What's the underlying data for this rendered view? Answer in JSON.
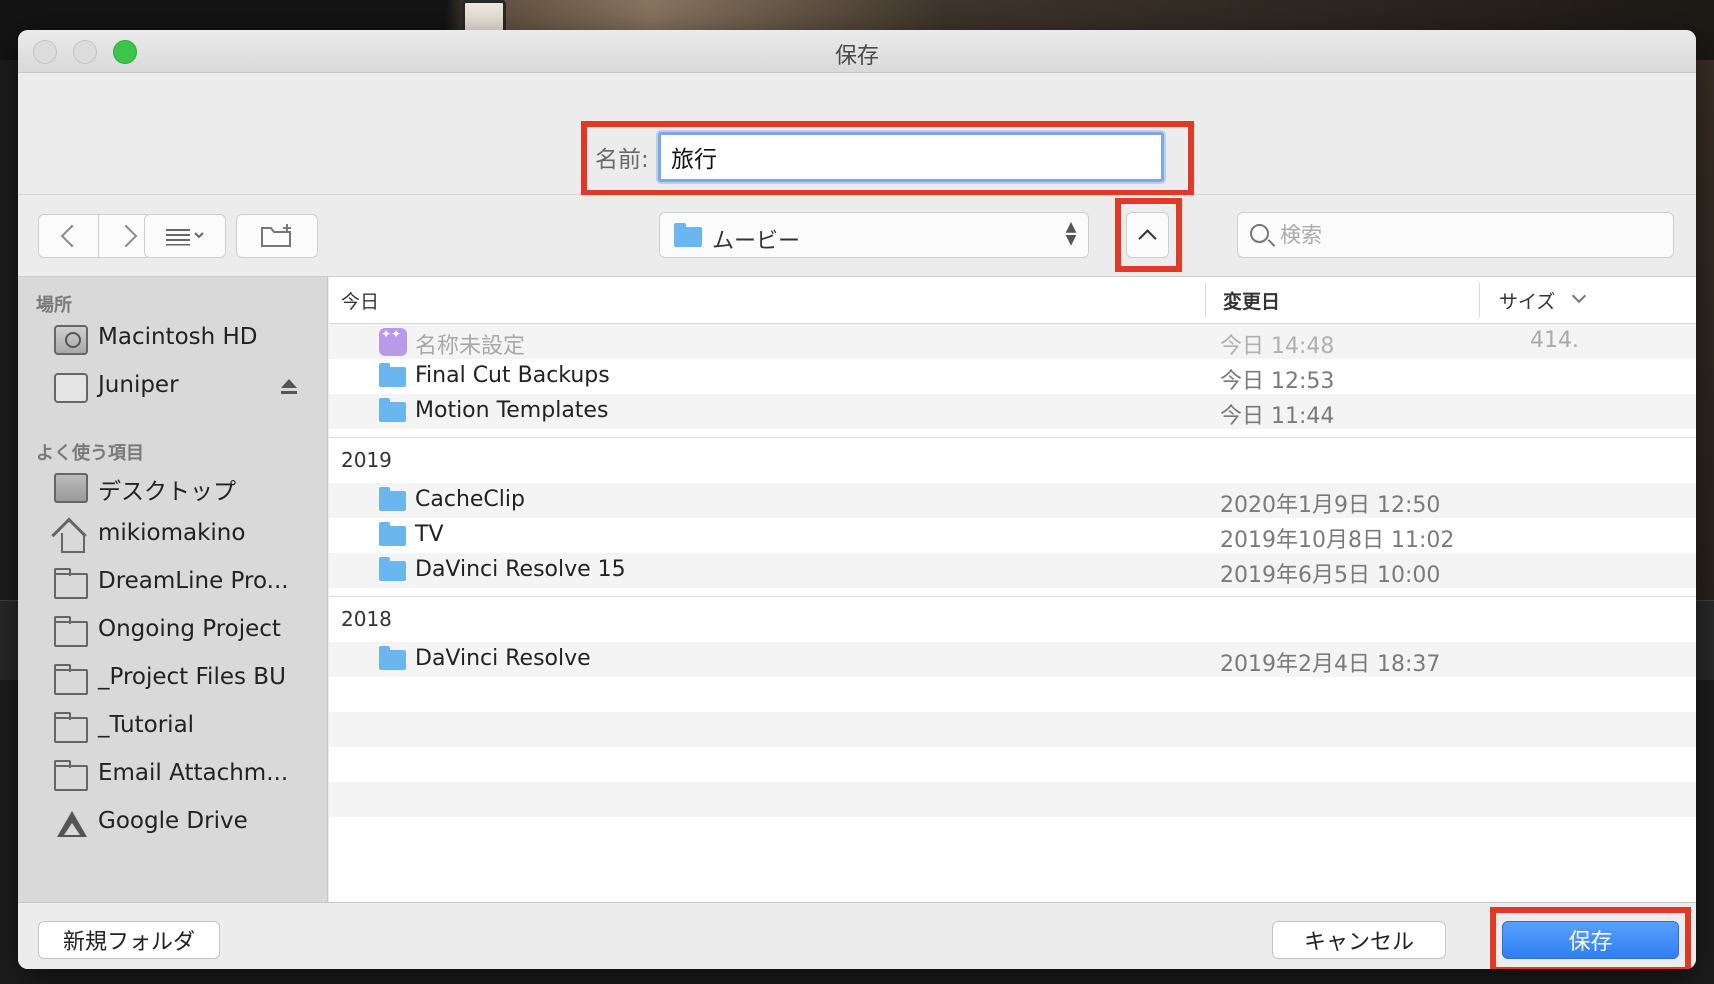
{
  "window": {
    "title": "保存"
  },
  "name_row": {
    "label": "名前:",
    "value": "旅行"
  },
  "toolbar": {
    "location": "ムービー",
    "search_placeholder": "検索"
  },
  "sidebar": {
    "sections": [
      {
        "title": "場所",
        "items": [
          {
            "label": "Macintosh HD",
            "icon": "hard-drive-icon"
          },
          {
            "label": "Juniper",
            "icon": "external-drive-icon",
            "eject": true
          }
        ]
      },
      {
        "title": "よく使う項目",
        "items": [
          {
            "label": "デスクトップ",
            "icon": "desktop-icon"
          },
          {
            "label": "mikiomakino",
            "icon": "home-icon"
          },
          {
            "label": "DreamLine Pro...",
            "icon": "folder-icon"
          },
          {
            "label": "Ongoing Project",
            "icon": "folder-icon"
          },
          {
            "label": "_Project Files BU",
            "icon": "folder-icon"
          },
          {
            "label": "_Tutorial",
            "icon": "folder-icon"
          },
          {
            "label": "Email Attachm...",
            "icon": "folder-icon"
          },
          {
            "label": "Google Drive",
            "icon": "google-drive-icon"
          }
        ]
      }
    ]
  },
  "filelist": {
    "columns": {
      "name": "今日",
      "modified": "変更日",
      "size": "サイズ"
    },
    "groups": [
      {
        "title": "",
        "rows": [
          {
            "name": "名称未設定",
            "date": "今日 14:48",
            "size": "414.",
            "icon": "project-file-icon",
            "disabled": true
          },
          {
            "name": "Final Cut Backups",
            "date": "今日 12:53",
            "size": "",
            "icon": "folder-icon",
            "disabled": false
          },
          {
            "name": "Motion Templates",
            "date": "今日 11:44",
            "size": "",
            "icon": "folder-icon",
            "disabled": false
          }
        ]
      },
      {
        "title": "2019",
        "rows": [
          {
            "name": "CacheClip",
            "date": "2020年1月9日 12:50",
            "size": "",
            "icon": "folder-icon"
          },
          {
            "name": "TV",
            "date": "2019年10月8日 11:02",
            "size": "",
            "icon": "folder-icon"
          },
          {
            "name": "DaVinci Resolve 15",
            "date": "2019年6月5日 10:00",
            "size": "",
            "icon": "folder-icon"
          }
        ]
      },
      {
        "title": "2018",
        "rows": [
          {
            "name": "DaVinci Resolve",
            "date": "2019年2月4日 18:37",
            "size": "",
            "icon": "folder-icon"
          }
        ]
      }
    ]
  },
  "buttons": {
    "new_folder": "新規フォルダ",
    "cancel": "キャンセル",
    "save": "保存"
  },
  "colors": {
    "highlight": "#e03a26",
    "accent": "#2f7ef5",
    "folder": "#6cb6ef"
  }
}
